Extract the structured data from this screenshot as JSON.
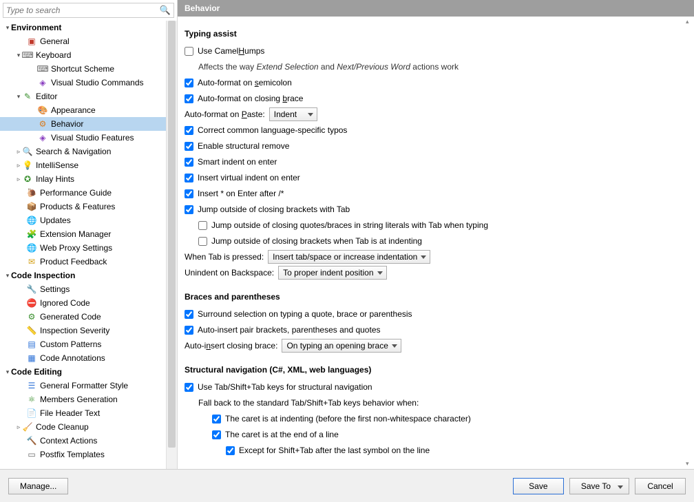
{
  "search": {
    "placeholder": "Type to search"
  },
  "panel_title": "Behavior",
  "tree": {
    "cat_environment": "Environment",
    "general": "General",
    "keyboard": "Keyboard",
    "shortcut_scheme": "Shortcut Scheme",
    "vs_commands": "Visual Studio Commands",
    "editor": "Editor",
    "appearance": "Appearance",
    "behavior": "Behavior",
    "vs_features": "Visual Studio Features",
    "search_nav": "Search & Navigation",
    "intellisense": "IntelliSense",
    "inlay_hints": "Inlay Hints",
    "perf_guide": "Performance Guide",
    "products_features": "Products & Features",
    "updates": "Updates",
    "ext_manager": "Extension Manager",
    "web_proxy": "Web Proxy Settings",
    "product_feedback": "Product Feedback",
    "cat_inspection": "Code Inspection",
    "insp_settings": "Settings",
    "ignored_code": "Ignored Code",
    "generated_code": "Generated Code",
    "insp_severity": "Inspection Severity",
    "custom_patterns": "Custom Patterns",
    "code_annotations": "Code Annotations",
    "cat_editing": "Code Editing",
    "gen_formatter": "General Formatter Style",
    "members_gen": "Members Generation",
    "file_header": "File Header Text",
    "code_cleanup": "Code Cleanup",
    "context_actions": "Context Actions",
    "postfix_templates": "Postfix Templates"
  },
  "s": {
    "typing_assist": "Typing assist",
    "use_camel_pre": "Use Camel",
    "use_camel_u": "H",
    "use_camel_post": "umps",
    "camel_help_pre": "Affects the way ",
    "camel_help_i1": "Extend Selection",
    "camel_help_mid": " and ",
    "camel_help_i2": "Next/Previous Word",
    "camel_help_post": " actions work",
    "af_semi_pre": "Auto-format on ",
    "af_semi_u": "s",
    "af_semi_post": "emicolon",
    "af_brace_pre": "Auto-format on closing ",
    "af_brace_u": "b",
    "af_brace_post": "race",
    "af_paste_label_pre": "Auto-format on ",
    "af_paste_u": "P",
    "af_paste_label_post": "aste:",
    "af_paste_value": "Indent",
    "correct_typos": "Correct common language-specific typos",
    "struct_remove": "Enable structural remove",
    "smart_indent": "Smart indent on enter",
    "virtual_indent": "Insert virtual indent on enter",
    "insert_star": "Insert * on Enter after /*",
    "jump_tab": "Jump outside of closing brackets with Tab",
    "jump_quotes": "Jump outside of closing quotes/braces in string literals with Tab when typing",
    "jump_indent": "Jump outside of closing brackets when Tab is at indenting",
    "tab_pressed_label": "When Tab is pressed:",
    "tab_pressed_value": "Insert tab/space or increase indentation",
    "unindent_label": "Unindent on Backspace:",
    "unindent_value": "To proper indent position",
    "braces_head": "Braces and parentheses",
    "surround": "Surround selection on typing a quote, brace or parenthesis",
    "auto_pair": "Auto-insert pair brackets, parentheses and quotes",
    "auto_close_label_pre": "Auto-i",
    "auto_close_u": "n",
    "auto_close_label_post": "sert closing brace:",
    "auto_close_value": "On typing an opening brace",
    "struct_nav_head": "Structural navigation (C#, XML, web languages)",
    "use_tab_struct": "Use Tab/Shift+Tab keys for structural navigation",
    "fallback": "Fall back to the standard Tab/Shift+Tab keys behavior when:",
    "caret_indent": "The caret is at indenting (before the first non-whitespace character)",
    "caret_eol": "The caret is at the end of a line",
    "except_shift": "Except for Shift+Tab after the last symbol on the line"
  },
  "footer": {
    "manage": "Manage...",
    "save": "Save",
    "save_to": "Save To",
    "cancel": "Cancel"
  }
}
